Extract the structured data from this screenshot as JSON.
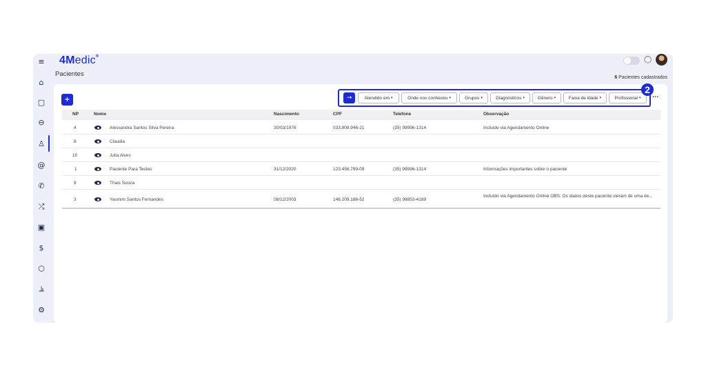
{
  "header": {
    "logo_main": "4M",
    "logo_light": "edic",
    "logo_sup": "®",
    "page_title": "Pacientes",
    "patient_count": "6",
    "patient_count_label": "Pacientes cadastrados"
  },
  "toolbar": {
    "add_label": "+",
    "go_label": "→",
    "more_label": "···",
    "step_badge": "2",
    "filters": [
      {
        "label": "Atendido em"
      },
      {
        "label": "Onde nos conheceu"
      },
      {
        "label": "Grupos"
      },
      {
        "label": "Diagnósticos"
      },
      {
        "label": "Gênero"
      },
      {
        "label": "Faixa de idade"
      },
      {
        "label": "Profissional"
      }
    ]
  },
  "sidebar": {
    "items": [
      {
        "icon": "menu-icon",
        "glyph": "≡"
      },
      {
        "icon": "home-icon",
        "glyph": "⌂"
      },
      {
        "icon": "calendar-icon",
        "glyph": "▢"
      },
      {
        "icon": "sofa-icon",
        "glyph": "⊖"
      },
      {
        "icon": "user-icon",
        "glyph": "♙"
      },
      {
        "icon": "at-icon",
        "glyph": "@"
      },
      {
        "icon": "phone-icon",
        "glyph": "✆"
      },
      {
        "icon": "shuffle-icon",
        "glyph": "⤮"
      },
      {
        "icon": "clipboard-icon",
        "glyph": "▣"
      },
      {
        "icon": "dollar-icon",
        "glyph": "$"
      },
      {
        "icon": "box-icon",
        "glyph": "⬡"
      },
      {
        "icon": "chart-icon",
        "glyph": "⫡"
      },
      {
        "icon": "gear-icon",
        "glyph": "⚙"
      }
    ]
  },
  "table": {
    "columns": [
      "NP",
      "Nome",
      "Nascimento",
      "CPF",
      "Telefone",
      "Observação"
    ],
    "rows": [
      {
        "np": "4",
        "nome": "Alessandra Santos Silva Pereira",
        "nascimento": "30/03/1976",
        "cpf": "033.808.946-21",
        "telefone": "(35) 99996-1314",
        "observacao": "Incluído via Agendamento Online"
      },
      {
        "np": "8",
        "nome": "Claudia",
        "nascimento": "",
        "cpf": "",
        "telefone": "",
        "observacao": ""
      },
      {
        "np": "10",
        "nome": "Julia Alves",
        "nascimento": "",
        "cpf": "",
        "telefone": "",
        "observacao": ""
      },
      {
        "np": "1",
        "nome": "Paciente Para Testes",
        "nascimento": "31/12/2020",
        "cpf": "123.456.789-09",
        "telefone": "(35) 99996-1314",
        "observacao": "Informações importantes sobre o paciente"
      },
      {
        "np": "9",
        "nome": "Thais Souza",
        "nascimento": "",
        "cpf": "",
        "telefone": "",
        "observacao": ""
      },
      {
        "np": "3",
        "nome": "Yasmim Santos Fernandes",
        "nascimento": "08/12/2003",
        "cpf": "146.209.186-52",
        "telefone": "(35) 98853-4189",
        "observacao": "Incluído via Agendamento Online OBS: Os dados deste paciente vieram de uma de..."
      }
    ]
  },
  "colors": {
    "accent": "#1d2bd6",
    "background": "#eef0f9"
  }
}
